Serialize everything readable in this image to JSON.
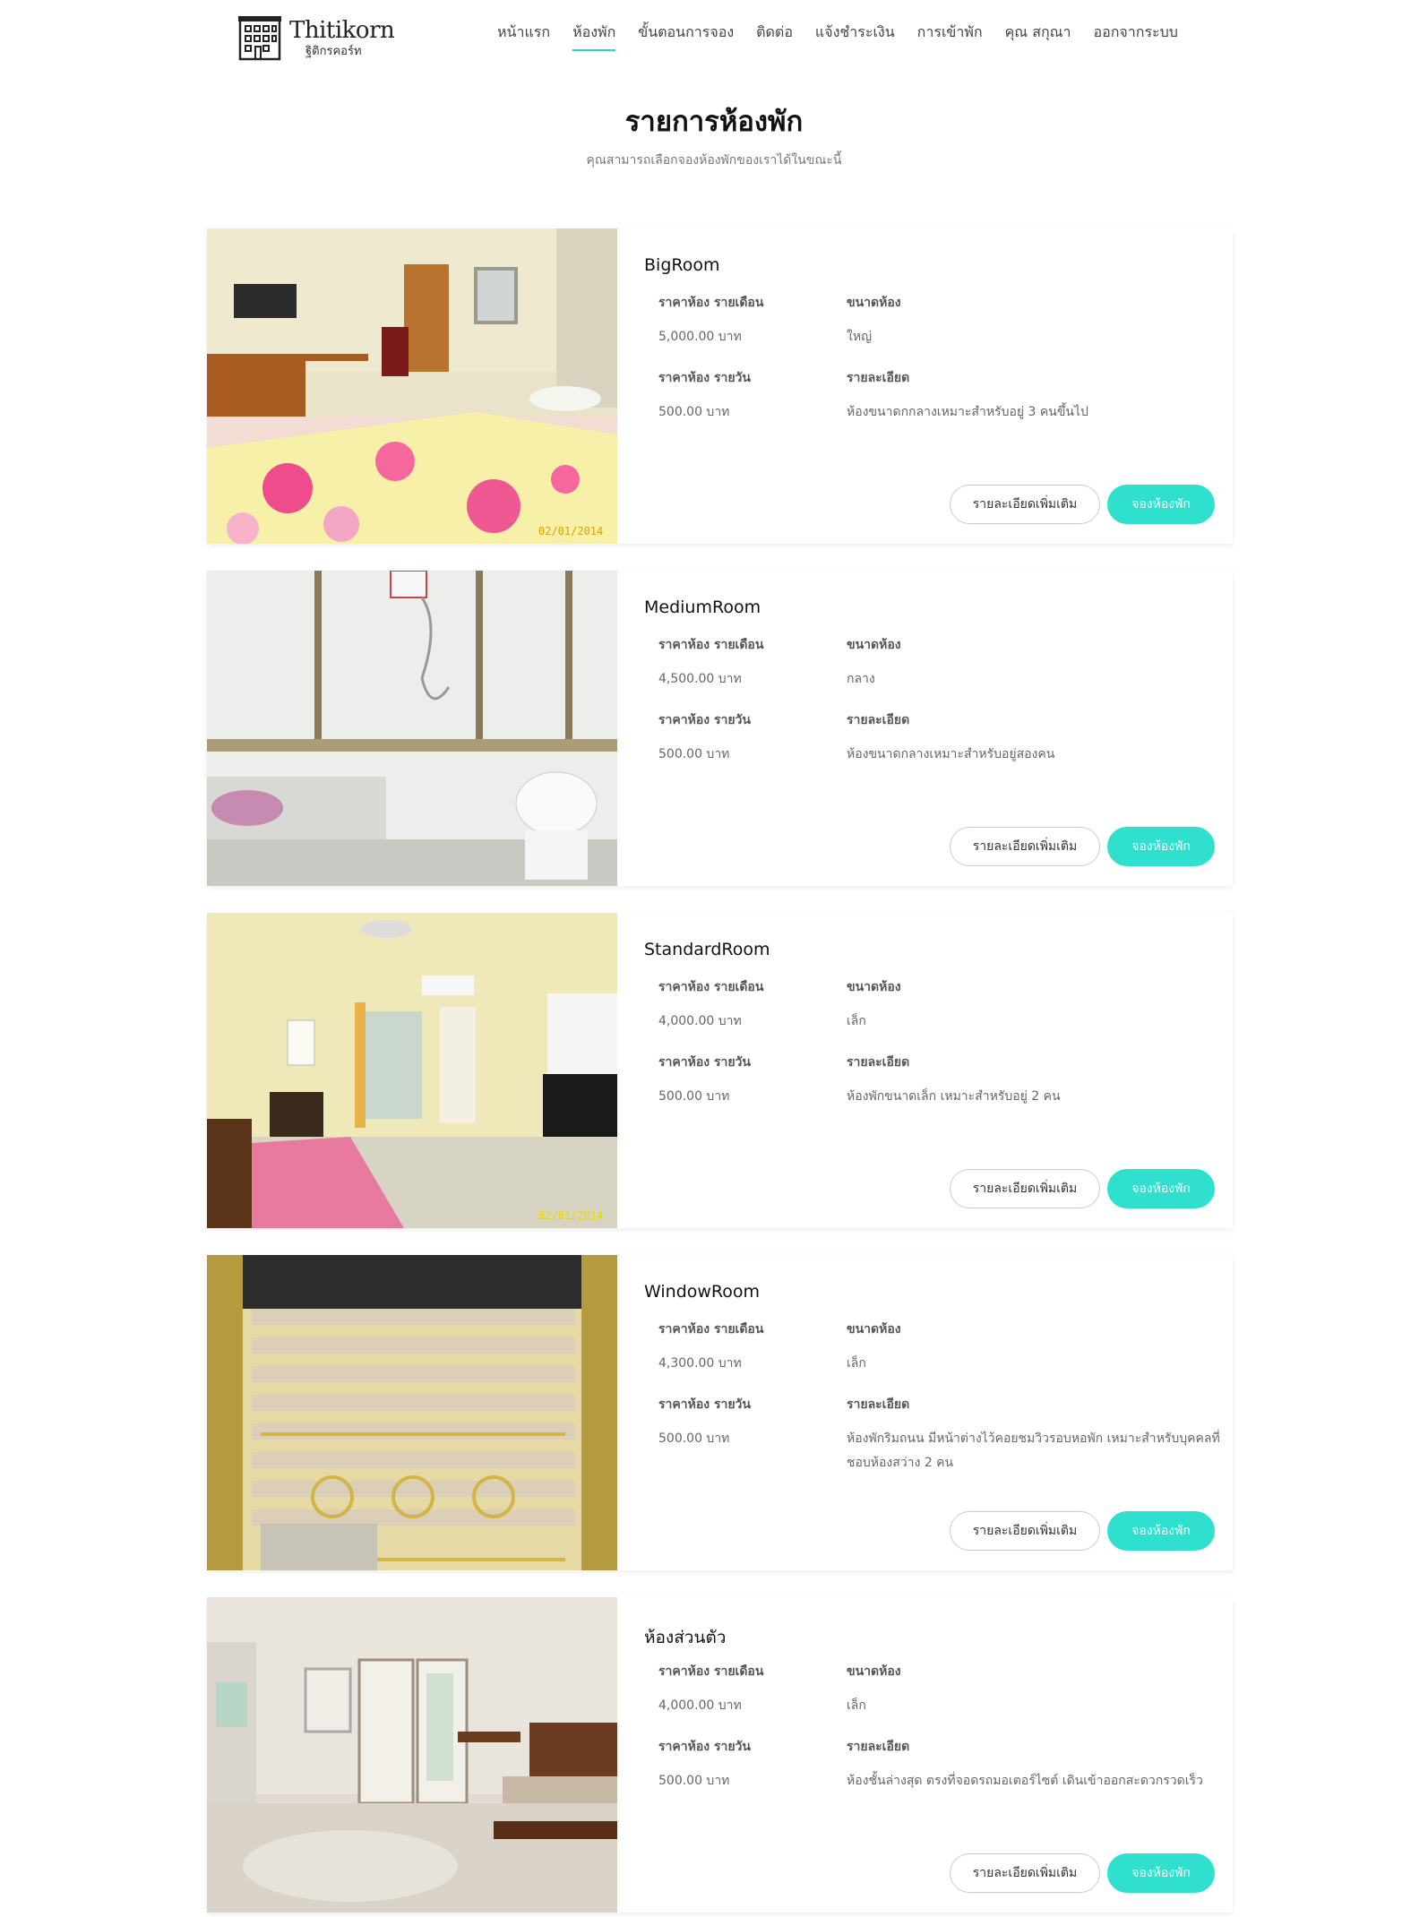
{
  "brand": {
    "title": "Thitikorn",
    "subtitle": "ฐิติกรคอร์ท"
  },
  "nav": {
    "items": [
      {
        "label": "หน้าแรก"
      },
      {
        "label": "ห้องพัก",
        "active": true
      },
      {
        "label": "ขั้นตอนการจอง"
      },
      {
        "label": "ติดต่อ"
      },
      {
        "label": "แจ้งชำระเงิน"
      },
      {
        "label": "การเข้าพัก"
      },
      {
        "label": "คุณ สกุณา"
      },
      {
        "label": "ออกจากระบบ"
      }
    ]
  },
  "page": {
    "title": "รายการห้องพัก",
    "subtitle": "คุณสามารถเลือกจองห้องพักของเราได้ในขณะนี้"
  },
  "labels": {
    "monthly": "ราคาห้อง รายเดือน",
    "size": "ขนาดห้อง",
    "daily": "ราคาห้อง รายวัน",
    "details": "รายละเอียด",
    "more_button": "รายละเอียดเพิ่มเติม",
    "book_button": "จองห้องพัก"
  },
  "rooms": [
    {
      "name": "BigRoom",
      "monthly": "5,000.00 บาท",
      "size": "ใหญ่",
      "daily": "500.00 บาท",
      "details": "ห้องขนาดกกลางเหมาะสำหรับอยู่ 3 คนขึ้นไป",
      "photo_stamp": "02/01/2014"
    },
    {
      "name": "MediumRoom",
      "monthly": "4,500.00 บาท",
      "size": "กลาง",
      "daily": "500.00 บาท",
      "details": "ห้องขนาดกลางเหมาะสำหรับอยู่สองคน",
      "photo_stamp": ""
    },
    {
      "name": "StandardRoom",
      "monthly": "4,000.00 บาท",
      "size": "เล็ก",
      "daily": "500.00 บาท",
      "details": "ห้องพักขนาดเล็ก เหมาะสำหรับอยู่ 2 คน",
      "photo_stamp": "02/01/2014"
    },
    {
      "name": "WindowRoom",
      "monthly": "4,300.00 บาท",
      "size": "เล็ก",
      "daily": "500.00 บาท",
      "details": "ห้องพักริมถนน มีหน้าต่างไว้คอยชมวิวรอบหอพัก เหมาะสำหรับบุคคลที่ชอบห้องสว่าง 2 คน",
      "photo_stamp": ""
    },
    {
      "name": "ห้องส่วนตัว",
      "monthly": "4,000.00 บาท",
      "size": "เล็ก",
      "daily": "500.00 บาท",
      "details": "ห้องชั้นล่างสุด ตรงที่จอดรถมอเตอร์ไซต์ เดินเข้าออกสะดวกรวดเร็ว",
      "photo_stamp": ""
    }
  ],
  "colors": {
    "accent": "#2fe0cf",
    "nav_underline": "#2bd6c4"
  }
}
